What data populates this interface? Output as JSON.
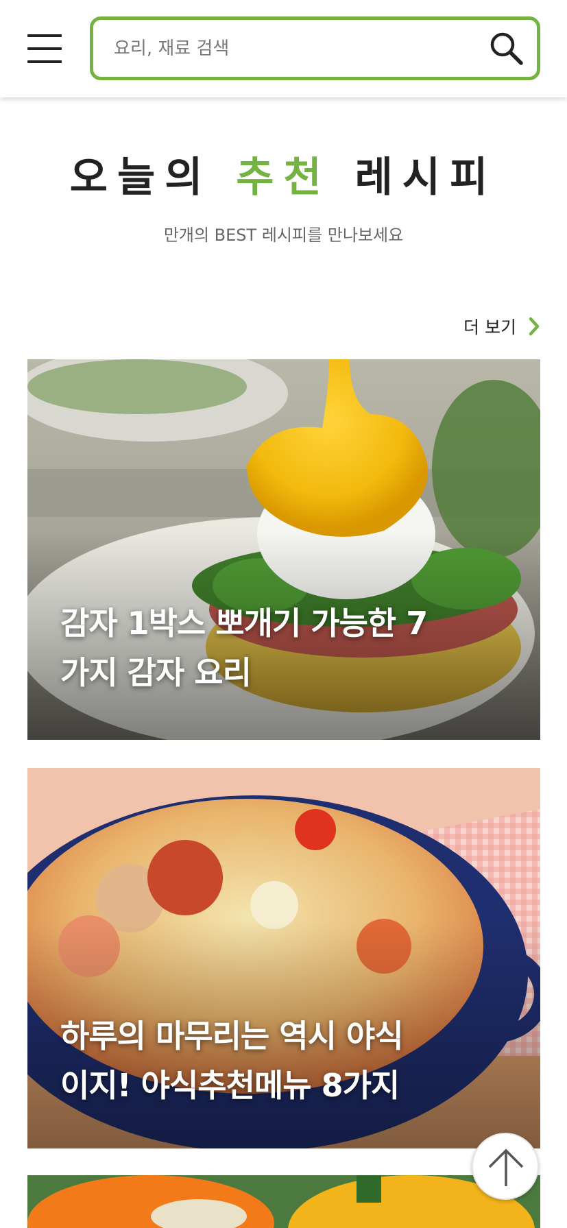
{
  "header": {
    "menu_icon": "hamburger-menu-icon",
    "search": {
      "placeholder": "요리, 재료 검색",
      "value": "",
      "icon": "search-icon"
    },
    "accent_color": "#74b243"
  },
  "section": {
    "title_part1": "오늘의",
    "title_accent": "추천",
    "title_part2": "레시피",
    "subtitle": "만개의 BEST 레시피를 만나보세요",
    "more_label": "더 보기",
    "more_icon": "chevron-right-icon"
  },
  "cards": [
    {
      "title": "감자 1박스 뽀개기 가능한 7가지 감자 요리",
      "image": "eggs-benedict-photo"
    },
    {
      "title": "하루의 마무리는 역시 야식이지! 야식추천메뉴 8가지",
      "image": "cheese-gratin-bowl-photo"
    },
    {
      "title": "",
      "image": "stuffed-peppers-photo"
    }
  ],
  "scroll_top": {
    "icon": "arrow-up-icon"
  }
}
